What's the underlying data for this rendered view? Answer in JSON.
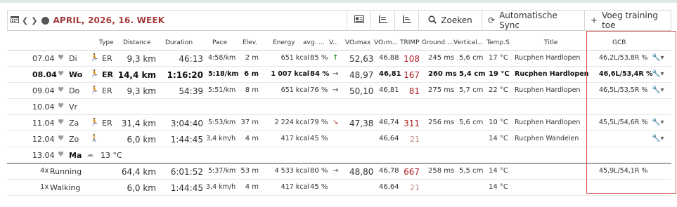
{
  "toolbar": {
    "title": "APRIL, 2026, 16. WEEK",
    "icons": [
      "calendar-icon",
      "chevron-left-icon",
      "chevron-right-icon",
      "circle-icon"
    ],
    "buttons": {
      "card_icon": "id-card-icon",
      "list_icon_1": "list-icon",
      "list_icon_2": "list-alt-icon",
      "search": "Zoeken",
      "sync": "Automatische Sync",
      "add": "Voeg training toe"
    }
  },
  "columns": {
    "type": "Type",
    "distance": "Distance",
    "duration": "Duration",
    "pace": "Pace",
    "elev": "Elev.",
    "energy": "Energy",
    "avg": "avg. ...",
    "v": "V...",
    "vo2max": "VO₂max",
    "vo2m": "VO₂m...",
    "trimp": "TRIMP",
    "ground": "Ground ...",
    "vertical": "Vertical...",
    "temp": "Temp.",
    "s": "S",
    "title": "Title",
    "gcb": "GCB"
  },
  "rows": [
    {
      "date": "07.04",
      "day": "Di",
      "type": "ER",
      "distance": "9,3 km",
      "duration": "46:13",
      "pace": "4:58/km",
      "elev": "2 m",
      "energy": "651 kcal",
      "avg": "85 %",
      "trend": "↑",
      "vo2max": "52,63",
      "vo2m": "46,88",
      "trimp": "108",
      "ground": "245 ms",
      "vertical": "5,6 cm",
      "temp": "17 °C",
      "title": "Rucphen Hardlopen",
      "gcb": "46,2L/53,8R %"
    },
    {
      "date": "08.04",
      "day": "Wo",
      "type": "ER",
      "distance": "14,4 km",
      "duration": "1:16:20",
      "pace": "5:18/km",
      "elev": "6 m",
      "energy": "1 007 kcal",
      "avg": "84 %",
      "trend": "→",
      "vo2max": "48,97",
      "vo2m": "46,81",
      "trimp": "167",
      "ground": "260 ms",
      "vertical": "5,4 cm",
      "temp": "19 °C",
      "title": "Rucphen Hardlopen",
      "gcb": "46,6L/53,4R %"
    },
    {
      "date": "09.04",
      "day": "Do",
      "type": "ER",
      "distance": "9,3 km",
      "duration": "54:39",
      "pace": "5:51/km",
      "elev": "8 m",
      "energy": "651 kcal",
      "avg": "76 %",
      "trend": "→",
      "vo2max": "50,10",
      "vo2m": "46,81",
      "trimp": "81",
      "ground": "275 ms",
      "vertical": "5,7 cm",
      "temp": "22 °C",
      "title": "Rucphen Hardlopen",
      "gcb": "46,5L/53,5R %"
    },
    {
      "date": "10.04",
      "day": "Vr"
    },
    {
      "date": "11.04",
      "day": "Za",
      "type": "ER",
      "distance": "31,4 km",
      "duration": "3:04:40",
      "pace": "5:53/km",
      "elev": "37 m",
      "energy": "2 224 kcal",
      "avg": "79 %",
      "trend": "↘",
      "vo2max": "47,38",
      "vo2m": "46,74",
      "trimp": "311",
      "ground": "256 ms",
      "vertical": "5,6 cm",
      "temp": "10 °C",
      "title": "Rucphen Hardlopen",
      "gcb": "45,5L/54,6R %"
    },
    {
      "date": "12.04",
      "day": "Zo",
      "distance": "6,0 km",
      "duration": "1:44:45",
      "pace": "3,4 km/h",
      "elev": "4 m",
      "energy": "417 kcal",
      "avg": "45 %",
      "vo2m": "46,64",
      "trimp": "21",
      "temp": "14 °C",
      "title": "Rucphen Wandelen"
    },
    {
      "date": "13.04",
      "day": "Ma",
      "weather": "13 °C"
    }
  ],
  "summary": [
    {
      "count": "4x",
      "label": "Running",
      "distance": "64,4 km",
      "duration": "6:01:52",
      "pace": "5:37/km",
      "elev": "53 m",
      "energy": "4 533 kcal",
      "avg": "80 %",
      "trend": "→",
      "vo2max": "48,80",
      "vo2m": "46,78",
      "trimp": "667",
      "ground": "258 ms",
      "vertical": "5,5 cm",
      "temp": "14 °C",
      "gcb": "45,9L/54,1R %"
    },
    {
      "count": "1x",
      "label": "Walking",
      "distance": "6,0 km",
      "duration": "1:44:45",
      "pace": "3,4 km/h",
      "elev": "4 m",
      "energy": "417 kcal",
      "avg": "45 %",
      "vo2m": "46,64",
      "trimp": "21",
      "temp": "14 °C"
    }
  ],
  "colors": {
    "title": "#a33a3a",
    "trimp": "#b01e1e",
    "highlight": "#d9534f",
    "trend_up": "#2e8b2e",
    "trend_down": "#b93a2a"
  }
}
